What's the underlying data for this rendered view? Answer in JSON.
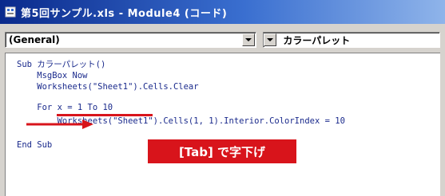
{
  "window": {
    "title": "第5回サンプル.xls - Module4 (コード)"
  },
  "toolbar": {
    "object_combo": "(General)",
    "procedure_combo": "カラーパレット"
  },
  "code": {
    "lines": [
      "Sub カラーパレット()",
      "    MsgBox Now",
      "    Worksheets(\"Sheet1\").Cells.Clear",
      "    For x = 1 To 10",
      "        Worksheets(\"Sheet1\").Cells(1, 1).Interior.ColorIndex = 10",
      "End Sub"
    ]
  },
  "annotation": {
    "callout_text": "[Tab] で字下げ",
    "accent_color": "#d8141b"
  },
  "icons": {
    "title_icon": "vba-module-icon",
    "dropdown_icon": "chevron-down-icon",
    "arrow_icon": "arrow-right-icon"
  }
}
